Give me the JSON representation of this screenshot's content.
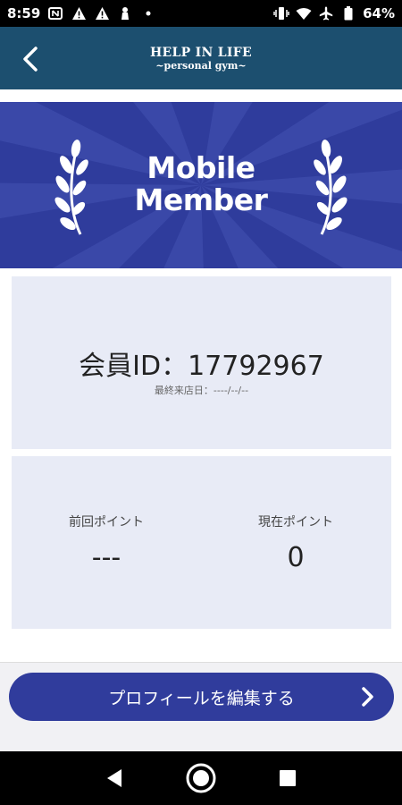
{
  "status_bar": {
    "time": "8:59",
    "battery": "64%",
    "left_icons": [
      "nfc-icon",
      "warning-icon",
      "warning-icon",
      "vpn-key-icon",
      "dot-icon"
    ],
    "right_icons": [
      "vibrate-icon",
      "wifi-icon",
      "airplane-icon",
      "battery-icon"
    ]
  },
  "header": {
    "logo_line1": "HELP IN LIFE",
    "logo_line2": "~personal gym~",
    "back_icon": "chevron-left-icon",
    "bg_color": "#1c4f6f"
  },
  "banner": {
    "title_line1": "Mobile",
    "title_line2": "Member",
    "bg_color": "#2f3c9c"
  },
  "member": {
    "id_text": "会員ID：17792967",
    "last_visit": "最終来店日：----/--/--"
  },
  "points": {
    "previous_label": "前回ポイント",
    "previous_value": "---",
    "current_label": "現在ポイント",
    "current_value": "0"
  },
  "action": {
    "edit_profile_label": "プロフィールを編集する",
    "color": "#303c9c"
  },
  "nav": {
    "icons": [
      "back-triangle-icon",
      "home-circle-icon",
      "recents-square-icon"
    ]
  }
}
